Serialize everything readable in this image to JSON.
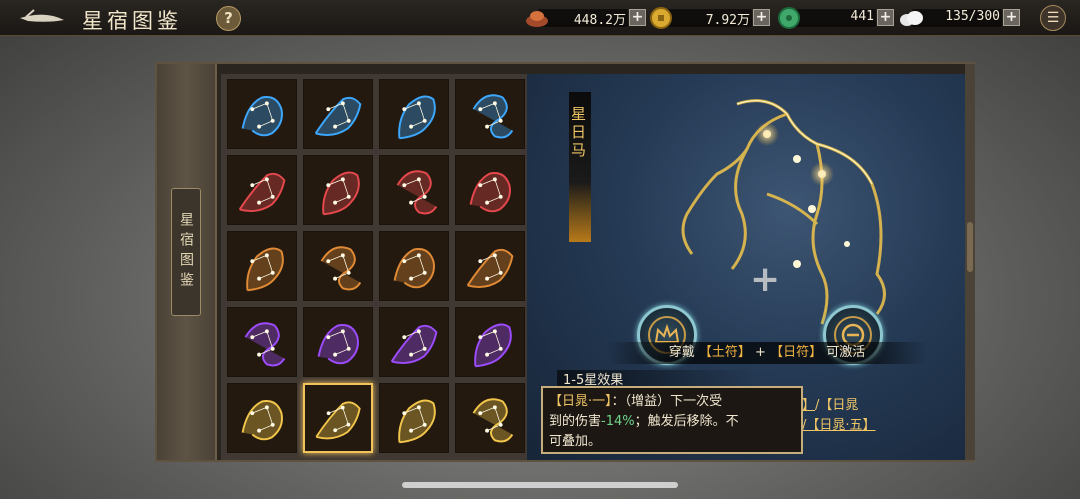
{
  "topbar": {
    "title": "星宿图鉴",
    "help_label": "?",
    "menu_label": "☰",
    "resources": [
      {
        "icon": "ingot-icon",
        "value": "448.2万"
      },
      {
        "icon": "gold-coin-icon",
        "value": "7.92万"
      },
      {
        "icon": "jade-icon",
        "value": "441"
      },
      {
        "icon": "stamina-cloud-icon",
        "value": "135/300"
      }
    ],
    "plus_label": "+"
  },
  "sidebar": {
    "tab_label": "星宿图鉴"
  },
  "grid": {
    "rows": [
      {
        "color": "blue",
        "items": [
          "tiger-constellation-icon",
          "wolf-constellation-icon",
          "bear-constellation-icon",
          "serpent-constellation-icon"
        ]
      },
      {
        "color": "red",
        "items": [
          "ox-constellation-icon",
          "pig-constellation-icon",
          "tiger-constellation-icon",
          "monkey-constellation-icon"
        ]
      },
      {
        "color": "orange",
        "items": [
          "pheasant-constellation-icon",
          "deer-constellation-icon",
          "boar-constellation-icon",
          "bat-constellation-icon"
        ]
      },
      {
        "color": "purple",
        "items": [
          "bird-constellation-icon",
          "stag-constellation-icon",
          "fox-constellation-icon",
          "swallow-constellation-icon"
        ]
      },
      {
        "color": "gold",
        "items": [
          "rat-constellation-icon",
          "horse-constellation-icon",
          "rabbit-constellation-icon",
          "rooster-constellation-icon"
        ]
      }
    ],
    "selected": "4-1",
    "palette": {
      "blue": "#3da8ff",
      "red": "#e5484d",
      "orange": "#e08a36",
      "purple": "#9d4cff",
      "gold": "#f2c64a"
    }
  },
  "detail": {
    "name": "星日马",
    "wear_prefix": "穿戴",
    "wear_item1": "【土符】",
    "wear_plus": "+",
    "wear_item2": "【日符】",
    "wear_suffix": "可激活",
    "effect_title": "1-5星效果",
    "links_line1_a": "一】",
    "links_line1_b": "/【日晁",
    "links_line2_a": "】",
    "links_line2_b": "/【日晁·五】"
  },
  "tooltip": {
    "line1_gold": "【日晁·一】",
    "line1_rest": "：（增益）下一次受",
    "line2_a": "到的伤害",
    "line2_green": "-14%",
    "line2_b": "；触发后移除。不",
    "line3": "可叠加。"
  }
}
